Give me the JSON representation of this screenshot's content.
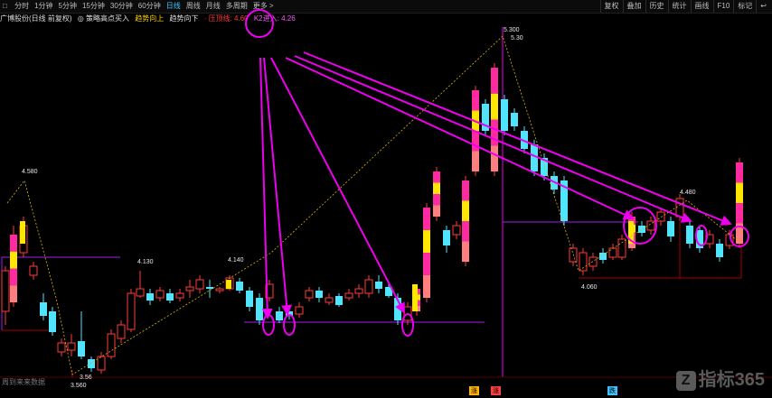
{
  "toolbar": {
    "stock_code": "□",
    "periods": [
      "分时",
      "1分钟",
      "5分钟",
      "15分钟",
      "30分钟",
      "60分钟",
      "日线",
      "周线",
      "月线",
      "多周期",
      "更多 >"
    ],
    "active_period": "日线",
    "right_buttons": [
      "复权",
      "叠加",
      "历史",
      "统计",
      "画线",
      "F10",
      "标记",
      "↩"
    ]
  },
  "legend": {
    "stock_name": "广博股份(日线 前复权)",
    "indicator1": "◎ 策略高点买入",
    "indicator2": "趋势向上",
    "indicator3": "趋势向下",
    "indicator4": "· 压顶线: 4.60",
    "indicator5": "K2进入: 4.26",
    "colors": {
      "i1": "#e0e0e0",
      "i2": "#ffd400",
      "i3": "#ff4d4d",
      "i4": "#ff3b3b",
      "i5": "#ff55ff"
    }
  },
  "price_labels": {
    "p1": "4.580",
    "p2": "4.130",
    "p3": "4.140",
    "p4": "5.300",
    "p5": "5.30",
    "p6": "4.480",
    "p7": "4.060",
    "p8": "3.560",
    "p9": "3.56"
  },
  "footnote": "周到来来数据",
  "bottom_tags": [
    "涨",
    "涨",
    "跌"
  ],
  "watermark": "指标365",
  "watermark_logo": "Z",
  "colors": {
    "up": "#ff3b3b",
    "down": "#4fe5ff",
    "bg": "#000000",
    "magenta": "#ee00ee",
    "support": "#a020f0",
    "yellow": "#ffe600",
    "pink": "#ff2aa0",
    "salmon": "#ff7f7f"
  }
}
